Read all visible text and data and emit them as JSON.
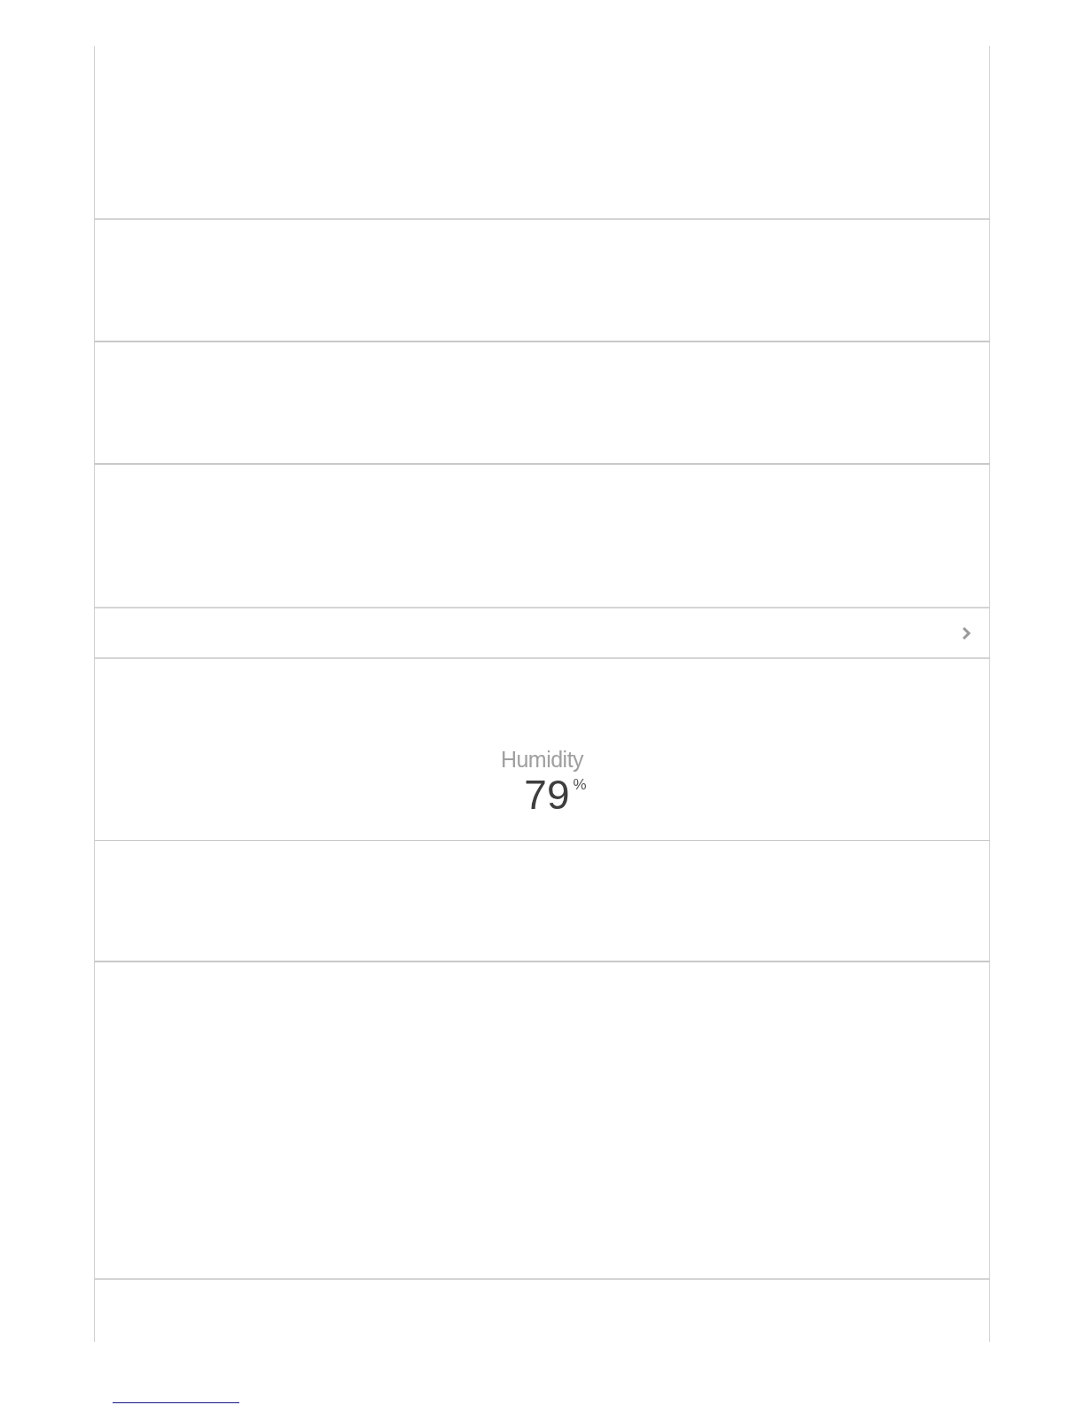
{
  "humidity": {
    "label": "Humidity",
    "value": "79",
    "unit": "%"
  }
}
